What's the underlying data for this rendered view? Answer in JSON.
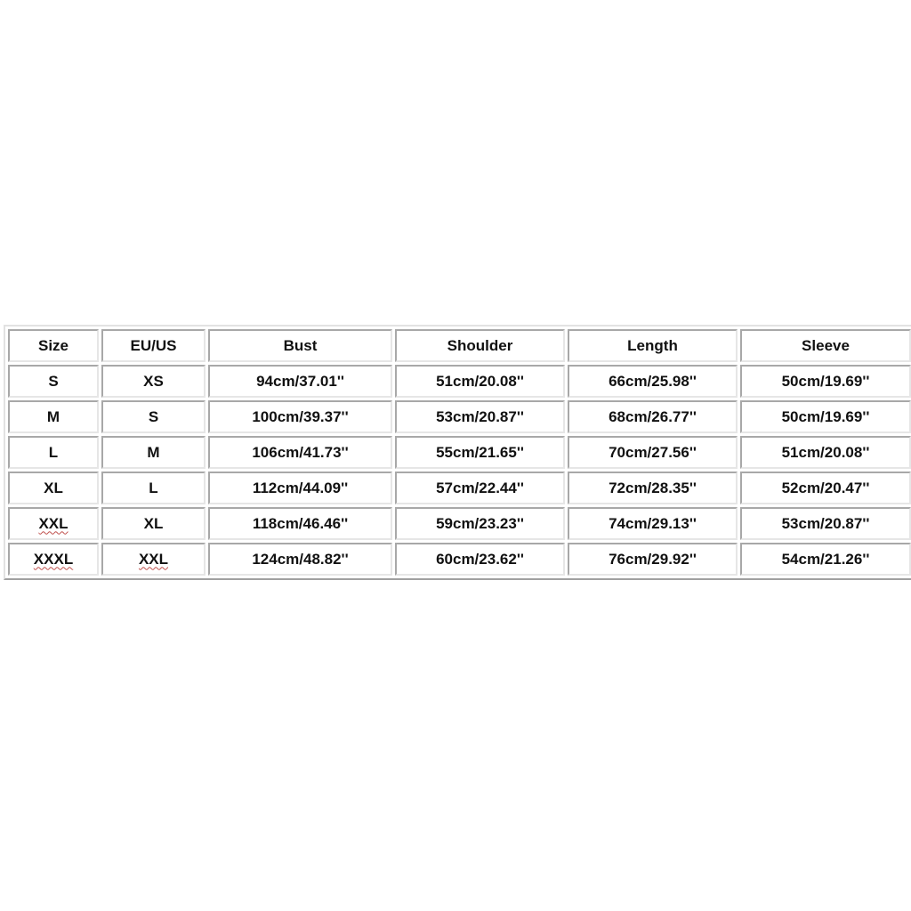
{
  "size_chart": {
    "headers": [
      "Size",
      "EU/US",
      "Bust",
      "Shoulder",
      "Length",
      "Sleeve"
    ],
    "rows": [
      {
        "size": "S",
        "eu_us": "XS",
        "bust": "94cm/37.01''",
        "shoulder": "51cm/20.08''",
        "length": "66cm/25.98''",
        "sleeve": "50cm/19.69''"
      },
      {
        "size": "M",
        "eu_us": "S",
        "bust": "100cm/39.37''",
        "shoulder": "53cm/20.87''",
        "length": "68cm/26.77''",
        "sleeve": "50cm/19.69''"
      },
      {
        "size": "L",
        "eu_us": "M",
        "bust": "106cm/41.73''",
        "shoulder": "55cm/21.65''",
        "length": "70cm/27.56''",
        "sleeve": "51cm/20.08''"
      },
      {
        "size": "XL",
        "eu_us": "L",
        "bust": "112cm/44.09''",
        "shoulder": "57cm/22.44''",
        "length": "72cm/28.35''",
        "sleeve": "52cm/20.47''"
      },
      {
        "size": "XXL",
        "eu_us": "XL",
        "bust": "118cm/46.46''",
        "shoulder": "59cm/23.23''",
        "length": "74cm/29.13''",
        "sleeve": "53cm/20.87''"
      },
      {
        "size": "XXXL",
        "eu_us": "XXL",
        "bust": "124cm/48.82''",
        "shoulder": "60cm/23.62''",
        "length": "76cm/29.92''",
        "sleeve": "54cm/21.26''"
      }
    ],
    "spellcheck_flagged": [
      "XXL",
      "XXXL"
    ],
    "colors": {
      "background": "#ffffff",
      "text": "#111111",
      "border_dark": "#a0a0a0",
      "border_light": "#e2e2e2",
      "spellcheck_underline": "#c0504d"
    }
  }
}
